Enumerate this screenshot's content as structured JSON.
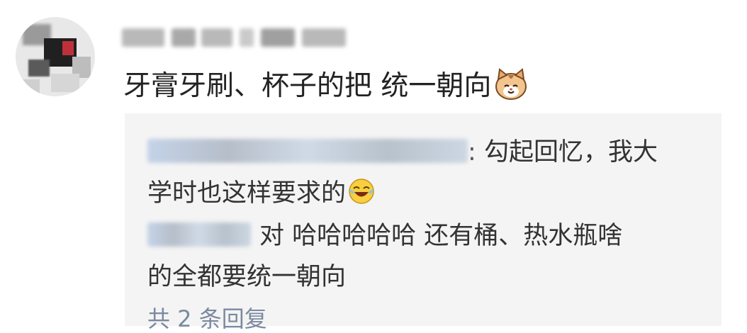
{
  "comment": {
    "text": "牙膏牙刷、杯子的把 统一朝向",
    "emoji": "cat-face-emoji"
  },
  "replies": [
    {
      "separator": ":",
      "text_line1": "勾起回忆，我大",
      "text_line2": "学时也这样要求的",
      "emoji": "laughing-crying-emoji"
    },
    {
      "text_line1": "对 哈哈哈哈哈 还有桶、热水瓶啥",
      "text_line2": "的全都要统一朝向"
    }
  ],
  "more_replies": "共 2 条回复",
  "colors": {
    "background": "#ffffff",
    "reply_box": "#f4f4f4",
    "text": "#222222",
    "link": "#7b8aa0"
  }
}
